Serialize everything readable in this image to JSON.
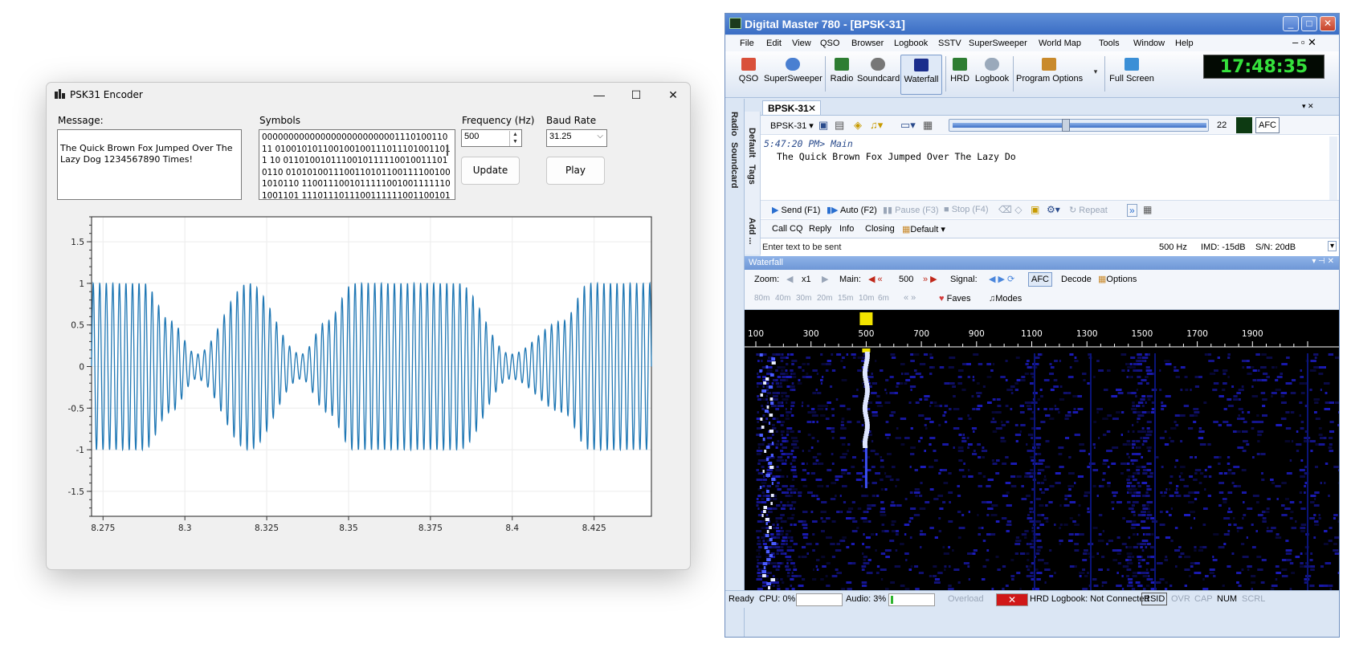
{
  "encoder": {
    "title": "PSK31 Encoder",
    "message_label": "Message:",
    "message_text": "The Quick Brown Fox Jumped Over The Lazy Dog 1234567890 Times!",
    "symbols_label": "Symbols",
    "symbols_text": "0000000000000000000000000111010011011 0100101011001001001110111010011011 10 01101001011100101111100100111010110 01010100111001101011001111001001010110 11001110010111110010011111101001101 1110111011100111111001100101101001010",
    "frequency_label": "Frequency (Hz)",
    "frequency_value": "500",
    "baud_label": "Baud Rate",
    "baud_value": "31.25",
    "update_label": "Update",
    "play_label": "Play",
    "window_buttons": {
      "minimize": "—",
      "maximize": "☐",
      "close": "✕"
    }
  },
  "chart_data": {
    "type": "line",
    "title": "",
    "xlabel": "",
    "ylabel": "",
    "xlim": [
      8.2715,
      8.4425
    ],
    "ylim": [
      -1.8,
      1.8
    ],
    "x_ticks": [
      8.275,
      8.3,
      8.325,
      8.35,
      8.375,
      8.4,
      8.425
    ],
    "x_tick_labels": [
      "8.275",
      "8.3",
      "8.325",
      "8.35",
      "8.375",
      "8.4",
      "8.425"
    ],
    "y_ticks": [
      1.5,
      1,
      0.5,
      0,
      -0.5,
      -1,
      -1.5
    ],
    "y_tick_labels": [
      "1.5",
      "1",
      "0.5",
      "0",
      "-0.5",
      "-1",
      "-1.5"
    ],
    "grid": true,
    "series": [
      {
        "carrier_hz": 500,
        "color": "#1f77b4",
        "envelope": {
          "x": [
            8.2715,
            8.2875,
            8.2955,
            8.3035,
            8.3195,
            8.3355,
            8.3435,
            8.3515,
            8.3835,
            8.3995,
            8.4155,
            8.4235,
            8.4315,
            8.4425
          ],
          "y": [
            1,
            1,
            0.55,
            0.15,
            1,
            0.15,
            0.55,
            1,
            1,
            0.15,
            0.55,
            1,
            1,
            1
          ]
        }
      }
    ]
  },
  "dm": {
    "title": "Digital Master 780 - [BPSK-31]",
    "menu": [
      "File",
      "Edit",
      "View",
      "QSO",
      "Browser",
      "Logbook",
      "SSTV",
      "SuperSweeper",
      "World Map",
      "Tools",
      "Window",
      "Help"
    ],
    "toolbar": [
      "QSO",
      "SuperSweeper",
      "Radio",
      "Soundcard",
      "Waterfall",
      "HRD",
      "Logbook",
      "Program Options",
      "Full Screen"
    ],
    "clock": "17:48:35",
    "side_tabs": [
      "Radio",
      "Soundcard"
    ],
    "side_tabs2": [
      "Default",
      "Tags",
      "Add ..."
    ],
    "doc_tab": "BPSK-31",
    "mode_select": "BPSK-31",
    "slider_value": "22",
    "afc": "AFC",
    "rx_header": "5:47:20 PM> Main",
    "rx_text": "The Quick Brown Fox Jumped Over The Lazy Do",
    "tx_buttons": [
      "Send (F1)",
      "Auto (F2)",
      "Pause (F3)",
      "Stop (F4)",
      "Repeat"
    ],
    "macros": [
      "Call CQ",
      "Reply",
      "Info",
      "Closing",
      "Default"
    ],
    "tx_placeholder": "Enter text to be sent",
    "tx_status": [
      "500 Hz",
      "IMD: -15dB",
      "S/N: 20dB"
    ],
    "waterfall_title": "Waterfall",
    "wf_zoom_label": "Zoom:",
    "wf_zoom": "x1",
    "wf_main_label": "Main:",
    "wf_main": "500",
    "wf_signal_label": "Signal:",
    "wf_afc": "AFC",
    "wf_decode": "Decode",
    "wf_options": "Options",
    "bands": [
      "80m",
      "40m",
      "30m",
      "20m",
      "15m",
      "10m",
      "6m"
    ],
    "faves": "Faves",
    "modes": "Modes",
    "scale": [
      "100",
      "300",
      "500",
      "700",
      "900",
      "1100",
      "1300",
      "1500",
      "1700",
      "1900"
    ],
    "status": {
      "ready": "Ready",
      "cpu": "CPU: 0%",
      "audio": "Audio: 3%",
      "audio_level": 0.03,
      "overload": "Overload",
      "hrd_logbook": "HRD Logbook: Not Connected",
      "flags": [
        "RSID",
        "OVR",
        "CAP",
        "NUM",
        "SCRL"
      ]
    }
  }
}
